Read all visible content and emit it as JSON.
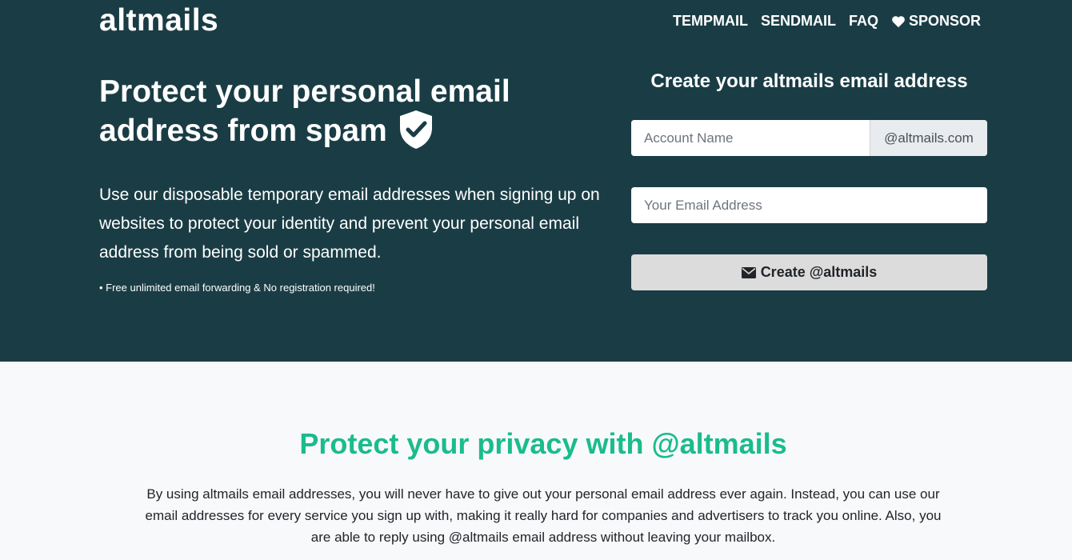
{
  "brand": {
    "logo": "altmails"
  },
  "nav": {
    "items": [
      "TEMPMAIL",
      "SENDMAIL",
      "FAQ"
    ],
    "sponsor": "SPONSOR"
  },
  "hero": {
    "headline": "Protect your personal email address from spam",
    "description": "Use our disposable temporary email addresses when signing up on websites to protect your identity and prevent your personal email address from being sold or spammed.",
    "note": "• Free unlimited email forwarding & No registration required!"
  },
  "form": {
    "title": "Create your altmails email address",
    "account_placeholder": "Account Name",
    "domain_suffix": "@altmails.com",
    "email_placeholder": "Your Email Address",
    "submit_label": "Create @altmails"
  },
  "privacy": {
    "heading": "Protect your privacy with @altmails",
    "body": "By using altmails email addresses, you will never have to give out your personal email address ever again. Instead, you can use our email addresses for every service you sign up with, making it really hard for companies and advertisers to track you online. Also, you are able to reply using @altmails email address without leaving your mailbox."
  },
  "colors": {
    "hero_bg": "#1a3d45",
    "accent": "#1abc8c",
    "section_bg": "#f8f9fb"
  },
  "icons": [
    "heart-icon",
    "shield-check-icon",
    "envelope-icon"
  ]
}
